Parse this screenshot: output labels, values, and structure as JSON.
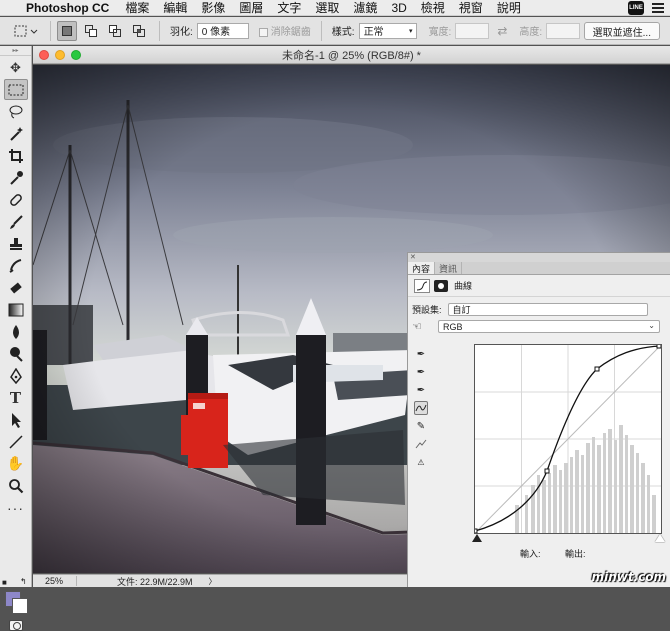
{
  "menubar": {
    "app_name": "Photoshop CC",
    "items": [
      "檔案",
      "編輯",
      "影像",
      "圖層",
      "文字",
      "選取",
      "濾鏡",
      "3D",
      "檢視",
      "視窗",
      "說明"
    ],
    "line_badge": "LINE"
  },
  "options": {
    "feather_label": "羽化:",
    "feather_value": "0 像素",
    "antialias_label": "消除鋸齒",
    "style_label": "樣式:",
    "style_value": "正常",
    "width_label": "寬度:",
    "height_label": "高度:",
    "select_mask_button": "選取並遮住..."
  },
  "document": {
    "title": "未命名-1 @ 25% (RGB/8#) *",
    "zoom": "25%",
    "doc_size": "文件: 22.9M/22.9M"
  },
  "properties": {
    "tabs": [
      "內容",
      "資訊"
    ],
    "adjustment_name": "曲線",
    "preset_label": "預設集:",
    "preset_value": "自訂",
    "channel_value": "RGB",
    "input_label": "輸入:",
    "output_label": "輸出:"
  },
  "colors": {
    "foreground": "#8d87c8",
    "background": "#ffffff"
  },
  "watermark": "minwt.com"
}
